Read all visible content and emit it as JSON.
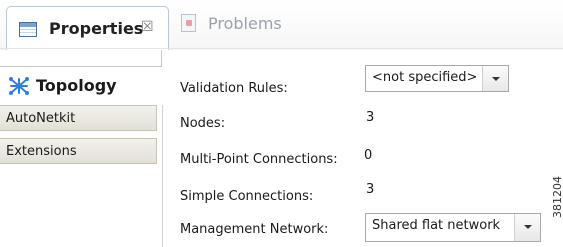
{
  "tabs": [
    {
      "label": "Properties",
      "icon": "properties-icon",
      "close_glyph": "☒"
    },
    {
      "label": "Problems",
      "icon": "problems-icon"
    }
  ],
  "sidebar": {
    "selected": {
      "label": "Topology",
      "icon": "topology-icon"
    },
    "items": [
      {
        "label": "AutoNetkit"
      },
      {
        "label": "Extensions"
      }
    ]
  },
  "form": {
    "validation_rules": {
      "label": "Validation Rules:",
      "value": "<not specified>"
    },
    "nodes": {
      "label": "Nodes:",
      "value": "3"
    },
    "multi_point": {
      "label": "Multi-Point Connections:",
      "value": "0"
    },
    "simple": {
      "label": "Simple Connections:",
      "value": "3"
    },
    "management_network": {
      "label": "Management Network:",
      "value": "Shared flat network"
    }
  },
  "figure_id": "381204",
  "colors": {
    "tab_border": "#b9c6d6",
    "side_tab_bg": "#e3e1d6",
    "topology_icon": "#2f7fd8"
  }
}
